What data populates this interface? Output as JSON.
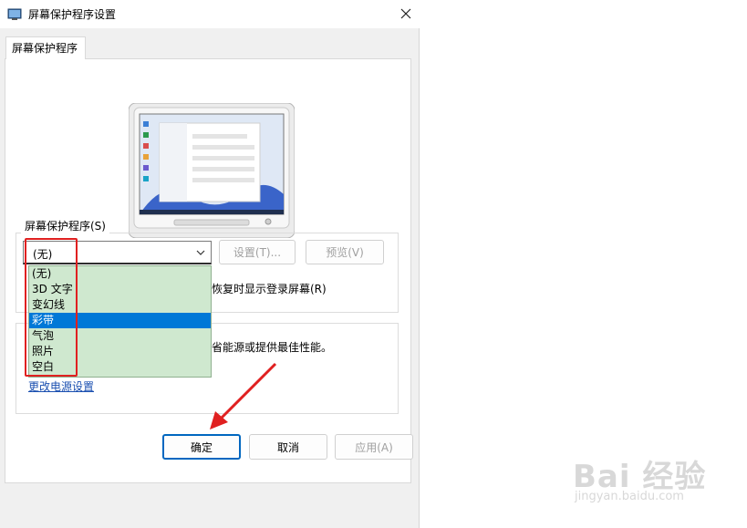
{
  "window": {
    "title": "屏幕保护程序设置",
    "close_glyph": "✕"
  },
  "tabs": [
    {
      "label": "屏幕保护程序"
    }
  ],
  "screensaver": {
    "group_label": "屏幕保护程序(S)",
    "selected_value": "(无)",
    "settings_button": "设置(T)...",
    "preview_button": "预览(V)",
    "resume_text": "恢复时显示登录屏幕(R)",
    "options": [
      "(无)",
      "3D 文字",
      "变幻线",
      "彩带",
      "气泡",
      "照片",
      "空白"
    ],
    "highlighted_option": "彩带"
  },
  "power": {
    "text_fragment": "省能源或提供最佳性能。",
    "link": "更改电源设置"
  },
  "footer": {
    "ok": "确定",
    "cancel": "取消",
    "apply": "应用(A)"
  },
  "watermark": {
    "logo_text": "Bai 经验",
    "url": "jingyan.baidu.com"
  },
  "colors": {
    "selection": "#0078d7",
    "dropdown_bg": "#cfe8cf",
    "annotation": "#e02020",
    "link": "#1a4fb0"
  }
}
